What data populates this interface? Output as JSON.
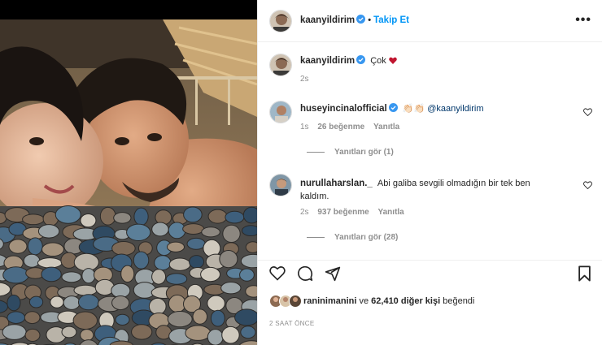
{
  "post": {
    "author": "kaanyildirim",
    "follow_label": "Takip Et",
    "caption_text": "Çok",
    "caption_age": "2s",
    "likers_lead": "raninimanini",
    "likers_joiner": "ve",
    "likes_others": "62,410 diğer kişi",
    "likes_suffix": "beğendi",
    "posted_time": "2 SAAT ÖNCE"
  },
  "comments": [
    {
      "user": "huseyincinalofficial",
      "emoji": "👏🏻👏🏻",
      "mention": "@kaanyildirim",
      "text": "",
      "age": "1s",
      "likes": "26 beğenme",
      "reply_label": "Yanıtla",
      "view_replies": "Yanıtları gör (1)"
    },
    {
      "user": "nurullaharslan._",
      "text_line1": "Abi galiba sevgili olmadığın bir tek ben",
      "text_line2": "kaldım.",
      "age": "2s",
      "likes": "937 beğenme",
      "reply_label": "Yanıtla",
      "view_replies": "Yanıtları gör (28)"
    }
  ],
  "colors": {
    "accent": "#0095f6",
    "verified": "#3897f0",
    "heart": "#ed4956",
    "muted": "#8e8e8e",
    "text": "#262626"
  },
  "icons": {
    "like": "heart-outline-icon",
    "comment": "comment-icon",
    "share": "paper-plane-icon",
    "save": "bookmark-icon",
    "more": "ellipsis-icon"
  }
}
